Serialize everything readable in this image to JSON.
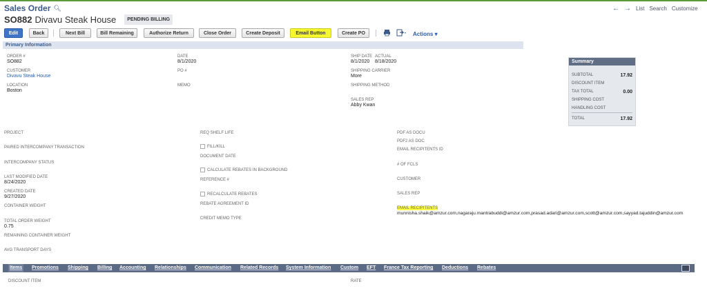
{
  "header": {
    "title": "Sales Order",
    "record_number": "SO882",
    "record_name": "Divavu Steak House",
    "status": "PENDING BILLING"
  },
  "nav": {
    "list": "List",
    "search": "Search",
    "customize": "Customize"
  },
  "toolbar": {
    "edit": "Edit",
    "back": "Back",
    "next_bill": "Next Bill",
    "bill_remaining": "Bill Remaining",
    "authorize_return": "Authorize Return",
    "close_order": "Close Order",
    "create_deposit": "Create Deposit",
    "email_button": "Email Button",
    "create_po": "Create PO",
    "actions": "Actions"
  },
  "primary_info": {
    "section_title": "Primary Information",
    "order_label": "ORDER #",
    "order_value": "SO882",
    "customer_label": "CUSTOMER",
    "customer_value": "Divavu Steak House",
    "location_label": "LOCATION",
    "location_value": "Boston",
    "date_label": "DATE",
    "date_value": "8/1/2020",
    "po_label": "PO #",
    "memo_label": "MEMO",
    "ship_date_label": "SHIP DATE",
    "ship_date_value": "8/1/2020",
    "actual_label": "ACTUAL",
    "actual_value": "8/18/2020",
    "carrier_label": "SHIPPING CARRIER",
    "carrier_value": "More",
    "method_label": "SHIPPING METHOD",
    "sales_rep_label": "SALES REP",
    "sales_rep_value": "Abby Kwan"
  },
  "summary": {
    "title": "Summary",
    "subtotal_label": "SUBTOTAL",
    "subtotal_value": "17.92",
    "discount_label": "DISCOUNT ITEM",
    "tax_label": "TAX TOTAL",
    "tax_value": "0.00",
    "shipping_label": "SHIPPING COST",
    "handling_label": "HANDLING COST",
    "total_label": "TOTAL",
    "total_value": "17.92"
  },
  "col1": {
    "project": "PROJECT",
    "paired": "PAIRED INTERCOMPANY TRANSACTION",
    "ic_status": "INTERCOMPANY STATUS",
    "last_modified_label": "LAST MODIFIED DATE",
    "last_modified_value": "8/24/2020",
    "created_label": "CREATED DATE",
    "created_value": "9/27/2020",
    "container_weight": "CONTAINER WEIGHT",
    "total_order_weight_label": "TOTAL ORDER WEIGHT",
    "total_order_weight_value": "0.75",
    "remaining_weight": "REMAINING CONTAINER WEIGHT",
    "avg_transport": "AVG TRANSPORT DAYS"
  },
  "col2": {
    "req_shelf": "REQ SHELF LIFE",
    "fill_kill": "FILL/KILL",
    "document_date": "DOCUMENT DATE",
    "calc_rebates": "CALCULATE REBATES IN BACKGROUND",
    "reference": "REFERENCE #",
    "recalc_rebates": "RECALCULATE REBATES",
    "rebate_agreement": "REBATE AGREEMENT ID",
    "credit_memo": "CREDIT MEMO TYPE"
  },
  "col3": {
    "pdf_docu": "PDF AS DOCU",
    "pdf2": "PDF2 AS DOC",
    "email_recip_id": "EMAIL RECIPITENTS ID",
    "num_fcls": "# OF FCLS",
    "customer": "CUSTOMER",
    "sales_rep": "SALES REP",
    "email_recip_label": "EMAIL RECIPITENTS",
    "email_recip_value": "munnisha.shaik@amzur.com,nagaraju.mantrabuddi@amzur.com,prasad.adari@amzur.com,scott@amzur.com,sayyad.tajuddin@amzur.com"
  },
  "tabs": [
    "Items",
    "Promotions",
    "Shipping",
    "Billing",
    "Accounting",
    "Relationships",
    "Communication",
    "Related Records",
    "System Information",
    "Custom",
    "EFT",
    "France Tax Reporting",
    "Deductions",
    "Rebates"
  ],
  "items_table": {
    "discount_item": "DISCOUNT ITEM",
    "rate": "RATE"
  },
  "colors": {
    "accent": "#3b5a8a",
    "highlight": "#f7f730",
    "tabbar": "#5c6b85"
  }
}
